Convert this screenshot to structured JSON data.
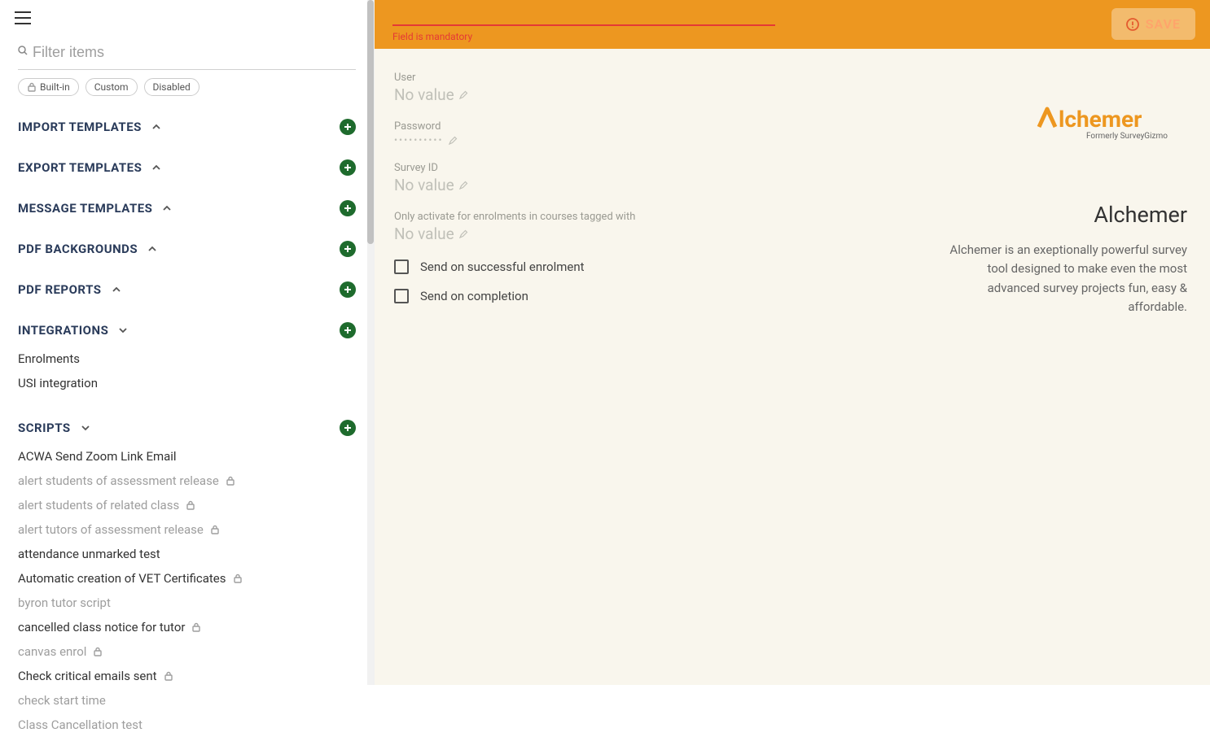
{
  "search": {
    "placeholder": "Filter items"
  },
  "chips": {
    "builtin": "Built-in",
    "custom": "Custom",
    "disabled": "Disabled"
  },
  "sections": {
    "import": "IMPORT TEMPLATES",
    "export": "EXPORT TEMPLATES",
    "message": "MESSAGE TEMPLATES",
    "pdfbg": "PDF BACKGROUNDS",
    "pdfrep": "PDF REPORTS",
    "integrations": "INTEGRATIONS",
    "scripts": "SCRIPTS"
  },
  "integrations_items": {
    "enrolments": "Enrolments",
    "usi": "USI integration"
  },
  "scripts_items": [
    {
      "label": "ACWA Send Zoom Link Email",
      "muted": false,
      "locked": false
    },
    {
      "label": "alert students of assessment release",
      "muted": true,
      "locked": true
    },
    {
      "label": "alert students of related class",
      "muted": true,
      "locked": true
    },
    {
      "label": "alert tutors of assessment release",
      "muted": true,
      "locked": true
    },
    {
      "label": "attendance unmarked test",
      "muted": false,
      "locked": false
    },
    {
      "label": "Automatic creation of VET Certificates",
      "muted": false,
      "locked": true
    },
    {
      "label": "byron tutor script",
      "muted": true,
      "locked": false
    },
    {
      "label": "cancelled class notice for tutor",
      "muted": false,
      "locked": true
    },
    {
      "label": "canvas enrol",
      "muted": true,
      "locked": true
    },
    {
      "label": "Check critical emails sent",
      "muted": false,
      "locked": true
    },
    {
      "label": "check start time",
      "muted": true,
      "locked": false
    },
    {
      "label": "Class Cancellation test",
      "muted": true,
      "locked": false
    }
  ],
  "topbar": {
    "error": "Field is mandatory",
    "save": "SAVE"
  },
  "form": {
    "user_label": "User",
    "user_value": "No value",
    "password_label": "Password",
    "password_value": "••••••••••",
    "survey_label": "Survey ID",
    "survey_value": "No value",
    "tag_label": "Only activate for enrolments in courses tagged with",
    "tag_value": "No value",
    "cb1": "Send on successful enrolment",
    "cb2": "Send on completion"
  },
  "brand": {
    "name": "Alchemer",
    "tagline": "Formerly SurveyGizmo",
    "title": "Alchemer",
    "desc": "Alchemer is an exeptionally powerful survey tool designed to make even the most advanced survey projects fun, easy & affordable."
  }
}
